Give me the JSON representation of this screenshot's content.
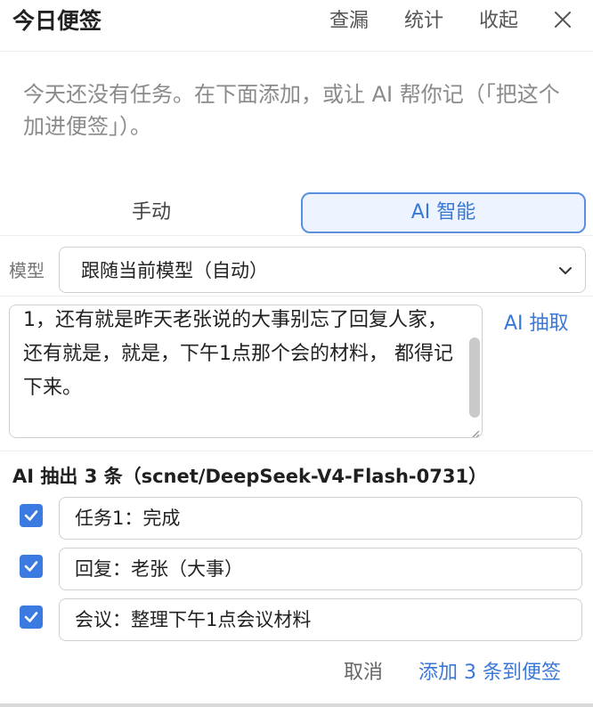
{
  "header": {
    "title": "今日便签",
    "actions": [
      "查漏",
      "统计",
      "收起"
    ],
    "close_icon": "close-icon"
  },
  "empty_state": "今天还没有任务。在下面添加，或让 AI 帮你记（「把这个加进便签」）。",
  "tabs": [
    {
      "label": "手动",
      "active": false
    },
    {
      "label": "AI 智能",
      "active": true
    }
  ],
  "model": {
    "label": "模型",
    "selected": "跟随当前模型（自动）"
  },
  "input": {
    "value": "1，还有就是昨天老张说的大事别忘了回复人家，还有就是，就是，下午1点那个会的材料， 都得记下来。"
  },
  "ai_extract_label": "AI 抽取",
  "result": {
    "heading": "AI 抽出 3 条（scnet/DeepSeek-V4-Flash-0731）",
    "items": [
      {
        "checked": true,
        "text": "任务1：完成"
      },
      {
        "checked": true,
        "text": "回复：老张（大事）"
      },
      {
        "checked": true,
        "text": "会议：整理下午1点会议材料"
      }
    ]
  },
  "footer": {
    "cancel_label": "取消",
    "add_label": "添加 3 条到便签"
  },
  "colors": {
    "accent": "#3a78d8",
    "checkbox": "#3b7ae0",
    "muted_text": "#8a8a8a"
  }
}
